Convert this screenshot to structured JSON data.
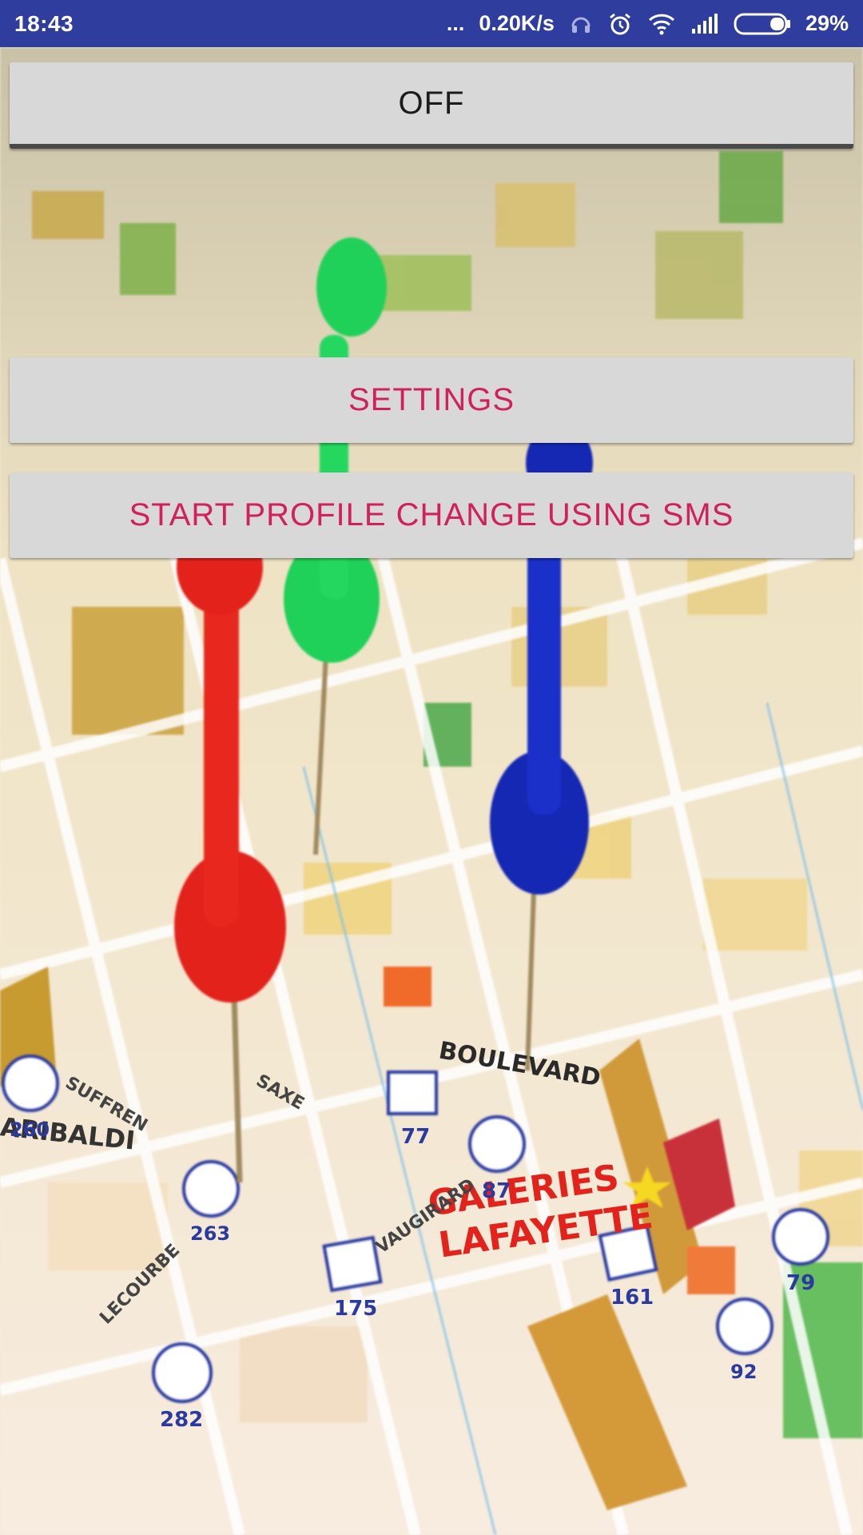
{
  "status_bar": {
    "time": "18:43",
    "dots": "...",
    "network_speed": "0.20K/s",
    "battery_percent": "29%",
    "battery_level": 0.29,
    "icons": [
      "headset-icon",
      "alarm-icon",
      "wifi-icon",
      "signal-icon",
      "battery-icon"
    ]
  },
  "main": {
    "toggle_label": "OFF",
    "settings_label": "SETTINGS",
    "sms_label": "START PROFILE CHANGE USING SMS"
  },
  "map_labels": {
    "boulevard": "BOULEVARD",
    "galeries": "GALERIES",
    "lafayette": "LAFAYETTE",
    "garibaldi": "ARIBALDI",
    "suffren": "SUFFREN",
    "saxe": "SAXE",
    "vaugirard": "VAUGIRARD",
    "lecourbe": "LECOURBE",
    "route_260": "260",
    "route_263": "263",
    "route_282": "282",
    "route_77": "77",
    "route_87": "87",
    "route_175": "175",
    "route_161": "161",
    "route_79": "79",
    "route_92": "92"
  },
  "colors": {
    "status_bar": "#2f3e9e",
    "button_bg": "#d8d8d8",
    "accent_text": "#d1205b",
    "pin_red": "#e3221c",
    "pin_green": "#1fd158",
    "pin_blue": "#1428b4"
  }
}
